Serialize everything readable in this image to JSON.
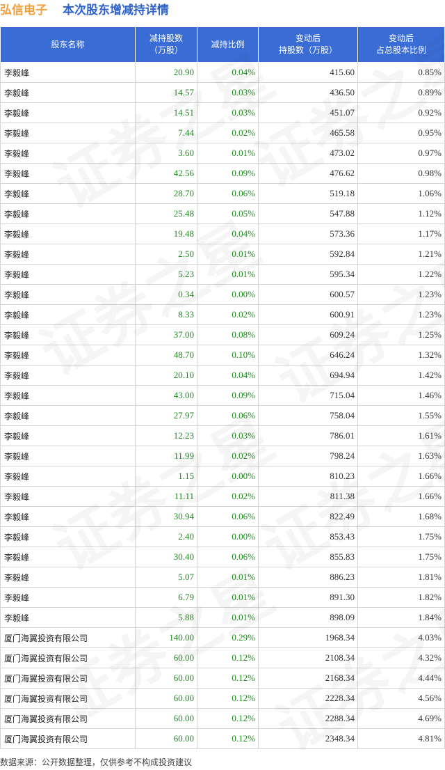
{
  "header": {
    "company": "弘信电子",
    "subtitle": "本次股东增减持详情"
  },
  "table": {
    "columns": [
      "股东名称",
      "减持股数\n（万股）",
      "减持比例",
      "变动后\n持股数（万股）",
      "变动后\n占总股本比例"
    ],
    "rows": [
      [
        "李毅峰",
        "20.90",
        "0.04%",
        "415.60",
        "0.85%"
      ],
      [
        "李毅峰",
        "14.57",
        "0.03%",
        "436.50",
        "0.89%"
      ],
      [
        "李毅峰",
        "14.51",
        "0.03%",
        "451.07",
        "0.92%"
      ],
      [
        "李毅峰",
        "7.44",
        "0.02%",
        "465.58",
        "0.95%"
      ],
      [
        "李毅峰",
        "3.60",
        "0.01%",
        "473.02",
        "0.97%"
      ],
      [
        "李毅峰",
        "42.56",
        "0.09%",
        "476.62",
        "0.98%"
      ],
      [
        "李毅峰",
        "28.70",
        "0.06%",
        "519.18",
        "1.06%"
      ],
      [
        "李毅峰",
        "25.48",
        "0.05%",
        "547.88",
        "1.12%"
      ],
      [
        "李毅峰",
        "19.48",
        "0.04%",
        "573.36",
        "1.17%"
      ],
      [
        "李毅峰",
        "2.50",
        "0.01%",
        "592.84",
        "1.21%"
      ],
      [
        "李毅峰",
        "5.23",
        "0.01%",
        "595.34",
        "1.22%"
      ],
      [
        "李毅峰",
        "0.34",
        "0.00%",
        "600.57",
        "1.23%"
      ],
      [
        "李毅峰",
        "8.33",
        "0.02%",
        "600.91",
        "1.23%"
      ],
      [
        "李毅峰",
        "37.00",
        "0.08%",
        "609.24",
        "1.25%"
      ],
      [
        "李毅峰",
        "48.70",
        "0.10%",
        "646.24",
        "1.32%"
      ],
      [
        "李毅峰",
        "20.10",
        "0.04%",
        "694.94",
        "1.42%"
      ],
      [
        "李毅峰",
        "43.00",
        "0.09%",
        "715.04",
        "1.46%"
      ],
      [
        "李毅峰",
        "27.97",
        "0.06%",
        "758.04",
        "1.55%"
      ],
      [
        "李毅峰",
        "12.23",
        "0.03%",
        "786.01",
        "1.61%"
      ],
      [
        "李毅峰",
        "11.99",
        "0.02%",
        "798.24",
        "1.63%"
      ],
      [
        "李毅峰",
        "1.15",
        "0.00%",
        "810.23",
        "1.66%"
      ],
      [
        "李毅峰",
        "11.11",
        "0.02%",
        "811.38",
        "1.66%"
      ],
      [
        "李毅峰",
        "30.94",
        "0.06%",
        "822.49",
        "1.68%"
      ],
      [
        "李毅峰",
        "2.40",
        "0.00%",
        "853.43",
        "1.75%"
      ],
      [
        "李毅峰",
        "30.40",
        "0.06%",
        "855.83",
        "1.75%"
      ],
      [
        "李毅峰",
        "5.07",
        "0.01%",
        "886.23",
        "1.81%"
      ],
      [
        "李毅峰",
        "6.79",
        "0.01%",
        "891.30",
        "1.82%"
      ],
      [
        "李毅峰",
        "5.88",
        "0.01%",
        "898.09",
        "1.84%"
      ],
      [
        "厦门海翼投资有限公司",
        "140.00",
        "0.29%",
        "1968.34",
        "4.03%"
      ],
      [
        "厦门海翼投资有限公司",
        "60.00",
        "0.12%",
        "2108.34",
        "4.32%"
      ],
      [
        "厦门海翼投资有限公司",
        "60.00",
        "0.12%",
        "2168.34",
        "4.44%"
      ],
      [
        "厦门海翼投资有限公司",
        "60.00",
        "0.12%",
        "2228.34",
        "4.56%"
      ],
      [
        "厦门海翼投资有限公司",
        "60.00",
        "0.12%",
        "2288.34",
        "4.69%"
      ],
      [
        "厦门海翼投资有限公司",
        "60.00",
        "0.12%",
        "2348.34",
        "4.81%"
      ]
    ]
  },
  "footer": {
    "source": "数据来源：公开数据整理，仅供参考不构成投资建议"
  },
  "watermark": "证券之星",
  "colors": {
    "header_bg": "#3a6cd6",
    "company_title": "#f0a040",
    "subtitle": "#2f63c8",
    "decrease_value": "#1f8a1f"
  }
}
